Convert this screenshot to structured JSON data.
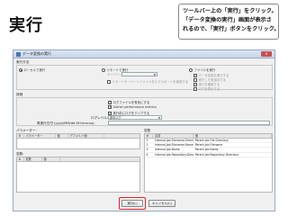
{
  "slide_title": "実行",
  "callout": {
    "lines": [
      "ツールバー上の「実行」をクリック。",
      "「データ変換の実行」画面が表示さ",
      "れるので、「実行」ボタンをクリック。"
    ]
  },
  "dialog": {
    "title": "データ変換の実行",
    "close_label": "✕",
    "section_execution": "実行方法",
    "radio_local": "ローカルで実行",
    "radio_remote": "リモートで実行",
    "remote_server_label": "サーバー(S):",
    "remote_checkbox": "リモートサーバーへファイルをエクスポートを使用する",
    "radio_file": "ファイルを実行",
    "file_options": [
      "データ変換を実行する",
      "実行した後保存する",
      "実行を確認する",
      "ログを表示する"
    ],
    "section_details": "詳細",
    "detail_checks": [
      {
        "label": "ログファイルを有効にする",
        "checked": true
      },
      {
        "label": "Gather performance metrics",
        "checked": true
      },
      {
        "label": "実行前にログをクリアする",
        "checked": true
      }
    ],
    "log_level_label": "ログレベル:",
    "log_level_value": "基本ログ",
    "replay_label": "再実行日付 (yyyy/MM/dd HH:mm:ss):",
    "params_title": "パラメーター:",
    "params_headers": [
      "#",
      "パラメーター",
      "値",
      "デフォルト値"
    ],
    "vars_title": "変数:",
    "vars_headers": [
      "#",
      "変数",
      "値"
    ],
    "env_title": "変数",
    "env_headers": [
      "#",
      "名前",
      "値"
    ],
    "env_rows": [
      [
        "1",
        "Internal.Job.Filename.Directory",
        "Parent Job File Directory"
      ],
      [
        "2",
        "Internal.Job.Filename.Name",
        "Parent Job Filename"
      ],
      [
        "3",
        "Internal.Job.Name",
        "Parent Job Name"
      ],
      [
        "4",
        "Internal.Job.Repository.Directory",
        "Parent Job Repository Directory"
      ]
    ],
    "run_button": "実行(L)",
    "cancel_button": "キャンセル(C)"
  },
  "colors": {
    "highlight": "#e2242a",
    "titlebar": "#c7d6ec"
  }
}
